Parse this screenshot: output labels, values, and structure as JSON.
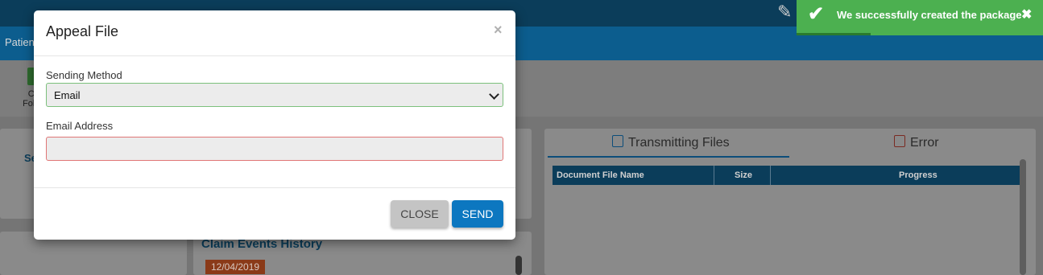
{
  "background": {
    "nav_text": "Patien",
    "toolbar_label": "Cl\nFollo",
    "panel_link": "Se",
    "history_title": "Claim Events History",
    "history_date": "12/04/2019",
    "tabs": [
      {
        "label": "Transmitting Files",
        "icon": "file-copy-icon"
      },
      {
        "label": "Error",
        "icon": "file-error-icon"
      }
    ],
    "grid_columns": [
      "Document File Name",
      "Size",
      "Progress"
    ]
  },
  "toast": {
    "message": "We successfully created the package",
    "close_glyph": "✖",
    "check_glyph": "✔",
    "color": "#4cb050"
  },
  "modal": {
    "title": "Appeal File",
    "close_glyph": "×",
    "sending_method_label": "Sending Method",
    "sending_method_value": "Email",
    "email_label": "Email Address",
    "email_value": "",
    "close_button": "CLOSE",
    "send_button": "SEND",
    "accent_color": "#0c77c0"
  }
}
